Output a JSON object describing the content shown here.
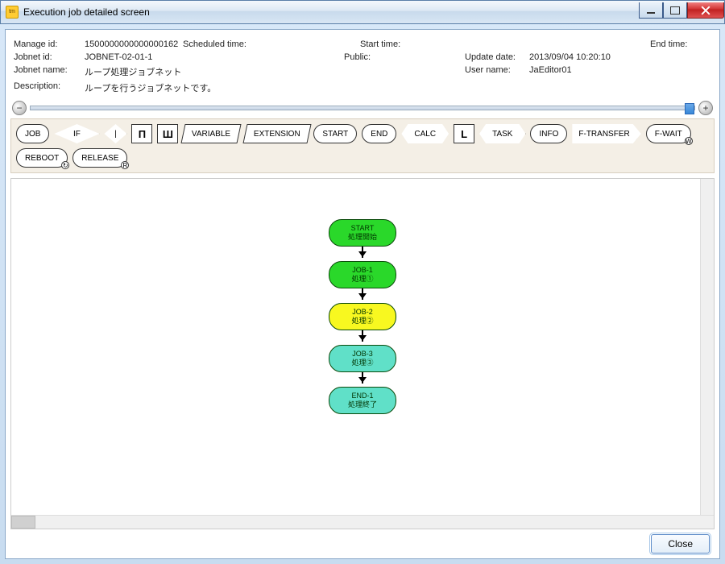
{
  "window": {
    "title": "Execution job detailed screen"
  },
  "info": {
    "manage_id_label": "Manage id:",
    "manage_id_value": "1500000000000000162",
    "scheduled_time_label": "Scheduled time:",
    "scheduled_time_value": "",
    "start_time_label": "Start time:",
    "start_time_value": "",
    "end_time_label": "End time:",
    "end_time_value": "",
    "jobnet_id_label": "Jobnet id:",
    "jobnet_id_value": "JOBNET-02-01-1",
    "public_label": "Public:",
    "public_value": "",
    "update_date_label": "Update date:",
    "update_date_value": "2013/09/04 10:20:10",
    "jobnet_name_label": "Jobnet name:",
    "jobnet_name_value": "ループ処理ジョブネット",
    "user_name_label": "User name:",
    "user_name_value": "JaEditor01",
    "description_label": "Description:",
    "description_value": "ループを行うジョブネットです。"
  },
  "palette": [
    {
      "id": "job",
      "label": "JOB",
      "shape": "pill"
    },
    {
      "id": "if",
      "label": "IF",
      "shape": "diamond"
    },
    {
      "id": "drop-i",
      "label": "I",
      "shape": "diamond small",
      "text": "|"
    },
    {
      "id": "merge-m",
      "label": "ᴍ",
      "shape": "box",
      "text": "П"
    },
    {
      "id": "merge-w",
      "label": "ш",
      "shape": "box",
      "text": "Ш"
    },
    {
      "id": "variable",
      "label": "VARIABLE",
      "shape": "parallel"
    },
    {
      "id": "extension",
      "label": "EXTENSION",
      "shape": "parallel"
    },
    {
      "id": "start",
      "label": "START",
      "shape": "pill"
    },
    {
      "id": "end",
      "label": "END",
      "shape": "pill"
    },
    {
      "id": "calc",
      "label": "CALC",
      "shape": "hex"
    },
    {
      "id": "loop",
      "label": "L",
      "shape": "box",
      "text": "L"
    },
    {
      "id": "task",
      "label": "TASK",
      "shape": "hex"
    },
    {
      "id": "info",
      "label": "INFO",
      "shape": "pill"
    },
    {
      "id": "ftransfer",
      "label": "F-TRANSFER",
      "shape": "house",
      "sub": "↘"
    },
    {
      "id": "fwait",
      "label": "F-WAIT",
      "shape": "pill",
      "sub": "W"
    },
    {
      "id": "reboot",
      "label": "REBOOT",
      "shape": "pill",
      "sub": "↻"
    },
    {
      "id": "release",
      "label": "RELEASE",
      "shape": "pill",
      "sub": "R"
    }
  ],
  "flow_nodes": [
    {
      "id": "start",
      "label1": "START",
      "label2": "処理開始",
      "color": "#2ad82a"
    },
    {
      "id": "job1",
      "label1": "JOB-1",
      "label2": "処理①",
      "color": "#2ad82a"
    },
    {
      "id": "job2",
      "label1": "JOB-2",
      "label2": "処理②",
      "color": "#f8f820"
    },
    {
      "id": "job3",
      "label1": "JOB-3",
      "label2": "処理③",
      "color": "#60e0c8"
    },
    {
      "id": "end1",
      "label1": "END-1",
      "label2": "処理終了",
      "color": "#60e0c8"
    }
  ],
  "footer": {
    "close": "Close"
  }
}
